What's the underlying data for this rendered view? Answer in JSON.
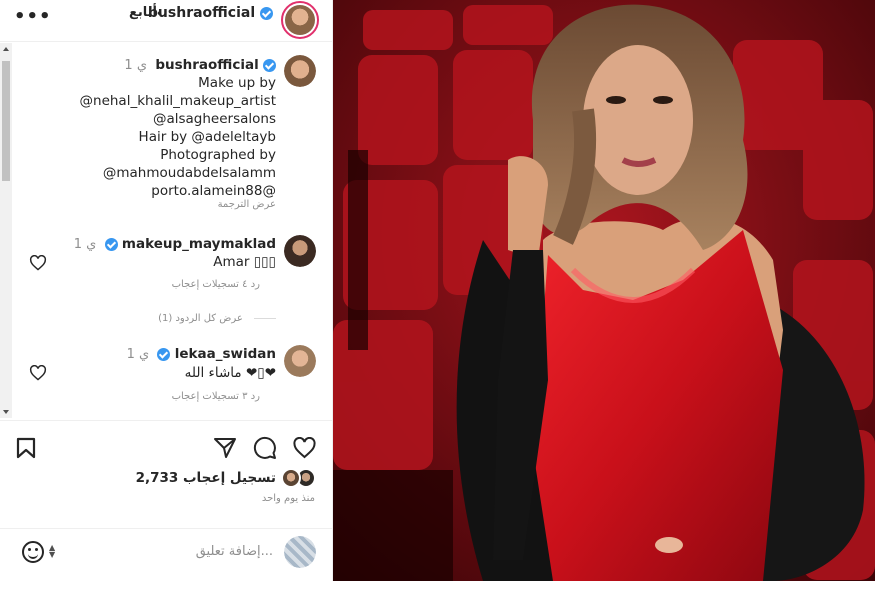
{
  "header": {
    "username": "bushraofficial",
    "follow_label": "أتابع",
    "separator": "•",
    "more": "•••"
  },
  "caption": {
    "username": "bushraofficial",
    "time": "1 ي",
    "lines": [
      "Make up by",
      "@nehal_khalil_makeup_artist",
      "@alsagheersalons",
      "Hair by @adeleltayb",
      "Photographed by",
      "@mahmoudabdelsalamm",
      "porto.alamein88@"
    ],
    "translation": "عرض الترجمة"
  },
  "comments": [
    {
      "username": "makeup_maymaklad",
      "time": "1 ي",
      "text": "Amar ▯▯▯",
      "likes": "٤ تسجيلات إعجاب",
      "reply": "رد",
      "view_replies": "عرض كل الردود (1)"
    },
    {
      "username": "lekaa_swidan",
      "time": "1 ي",
      "text": "ماشاء الله ❤▯❤",
      "likes": "٣ تسجيلات إعجاب",
      "reply": "رد"
    }
  ],
  "actions": {
    "like_icon": "heart-icon",
    "comment_icon": "comment-icon",
    "share_icon": "share-icon",
    "save_icon": "bookmark-icon"
  },
  "likes_text": "2,733 تسجيل إعجاب",
  "posted_ago": "منذ يوم واحد",
  "add_comment": {
    "placeholder": "إضافة تعليق..."
  },
  "colors": {
    "verified": "#3897f0",
    "muted": "#8e8e8e",
    "text": "#262626"
  }
}
